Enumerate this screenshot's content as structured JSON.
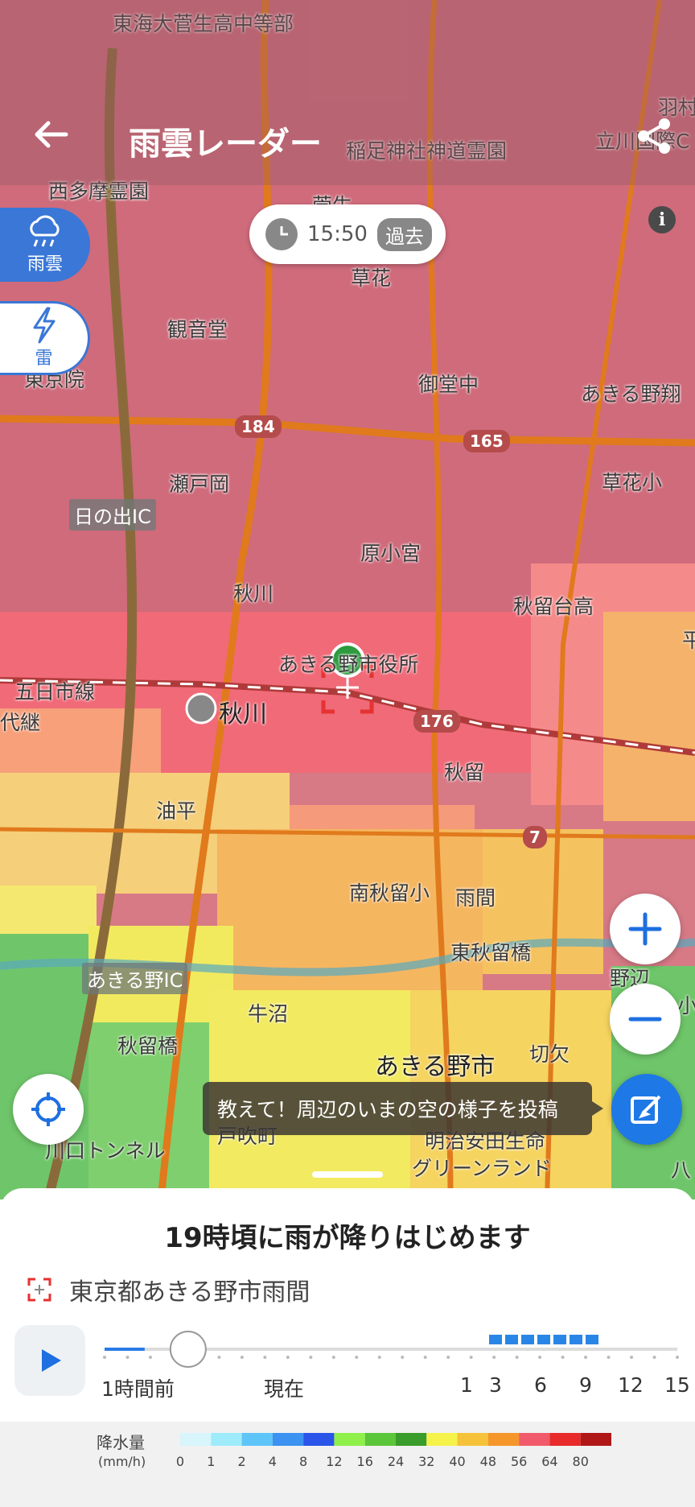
{
  "header": {
    "title": "雨雲レーダー",
    "back_icon": "arrow-left-icon",
    "share_icon": "share-icon"
  },
  "side_buttons": [
    {
      "label": "雨雲",
      "icon": "rain-cloud-icon",
      "active": true
    },
    {
      "label": "雷",
      "icon": "lightning-icon",
      "active": false
    }
  ],
  "time_pill": {
    "time": "15:50",
    "badge": "過去",
    "icon": "clock-icon"
  },
  "map": {
    "place_labels": [
      "東海大菅生高中等部",
      "稲足神社神道霊園",
      "立川国際C",
      "羽村",
      "西多摩霊園",
      "菅生",
      "草花",
      "観音堂",
      "東京院",
      "御堂中",
      "あきる野翔",
      "瀬戸岡",
      "草花小",
      "原小宮",
      "秋川",
      "秋留台高",
      "あきる野市役所",
      "五日市線",
      "代継",
      "秋川",
      "秋留",
      "油平",
      "南秋留小",
      "雨間",
      "東秋留橋",
      "野辺",
      "小",
      "牛沼",
      "秋留橋",
      "あきる野市",
      "切欠",
      "戸吹町",
      "明治安田生命",
      "グリーンランド",
      "川口トンネル",
      "八",
      "平"
    ],
    "ic_labels": [
      "日の出IC",
      "あきる野IC"
    ],
    "route_shields": [
      "184",
      "165",
      "176",
      "7"
    ],
    "station": "秋川",
    "colors": {
      "rain_heavy": "#e85a6a",
      "rain_mid": "#f59a55",
      "rain_light": "#f5e860",
      "rain_lowest": "#6fc66a",
      "road": "#e07a1c"
    }
  },
  "buttons": {
    "zoom_in_icon": "plus-icon",
    "zoom_out_icon": "minus-icon",
    "locate_icon": "crosshair-icon",
    "post_icon": "edit-icon",
    "info_icon": "info-icon"
  },
  "post_prompt": "教えて！周辺のいまの空の様子を投稿",
  "sheet": {
    "forecast": "19時頃に雨が降りはじめます",
    "location": "東京都あきる野市雨間",
    "location_icon": "target-icon",
    "play_icon": "play-icon",
    "timeline_labels": [
      "1時間前",
      "現在",
      "1",
      "3",
      "6",
      "9",
      "12",
      "15"
    ],
    "timeline_progress": 0.07
  },
  "legend": {
    "title": "降水量",
    "unit": "(mm/h)",
    "values": [
      "0",
      "1",
      "2",
      "4",
      "8",
      "12",
      "16",
      "24",
      "32",
      "40",
      "48",
      "56",
      "64",
      "80"
    ],
    "colors": [
      "#d8f5fb",
      "#9eecfb",
      "#5ec5f8",
      "#3b92f0",
      "#2a55e8",
      "#8ff04a",
      "#5cc63a",
      "#3a9c2a",
      "#f5f24a",
      "#f5c23a",
      "#f5962a",
      "#f05a6a",
      "#e82a2a",
      "#b01818"
    ]
  }
}
